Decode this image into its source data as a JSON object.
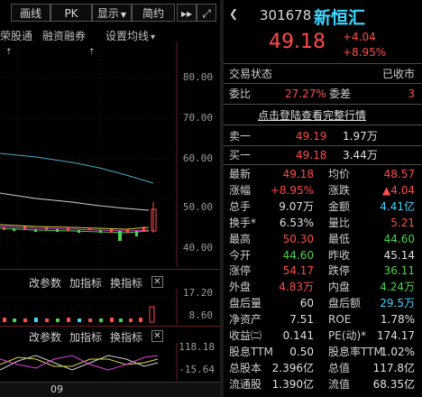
{
  "toolbar": {
    "btn1": "画线",
    "btn2": "PK",
    "btn3": "显示",
    "btn4": "简约",
    "btn5": "▸▸",
    "btn6": "⤢"
  },
  "subbar": {
    "left_label": "荣股通",
    "label2": "融资融券",
    "label3": "设置均线",
    "caret": "▾"
  },
  "price_axis": [
    "80.00",
    "70.00",
    "60.00",
    "50.00",
    "40.00"
  ],
  "indicator_bar1": {
    "change": "改参数",
    "add": "加指标",
    "swap": "换指标",
    "close": "✕"
  },
  "volume_axis": [
    "17.20",
    "8.60"
  ],
  "indicator_bar2": {
    "change": "改参数",
    "add": "加指标",
    "swap": "换指标",
    "close": "✕"
  },
  "osc_axis": [
    "118.18",
    "-15.64"
  ],
  "date_label": "09",
  "quote": {
    "code": "301678",
    "name": "新恒汇",
    "price": "49.18",
    "change": "+4.04",
    "change_pct": "+8.95%",
    "trade_status_label": "交易状态",
    "trade_status": "已收市",
    "weibi_label": "委比",
    "weibi": "27.27%",
    "weicha_label": "委差",
    "weicha": "3",
    "login_link": "点击登陆查看完整行情",
    "sell1_label": "卖一",
    "sell1_price": "49.19",
    "sell1_vol": "1.97万",
    "buy1_label": "买一",
    "buy1_price": "49.18",
    "buy1_vol": "3.44万",
    "rows": [
      {
        "l1": "最新",
        "v1": "49.18",
        "c1": "red",
        "l2": "均价",
        "v2": "48.57",
        "c2": "red"
      },
      {
        "l1": "涨幅",
        "v1": "+8.95%",
        "c1": "red",
        "l2": "涨跌",
        "v2": "▲4.04",
        "c2": "red"
      },
      {
        "l1": "总手",
        "v1": "9.07万",
        "c1": "white",
        "l2": "金额",
        "v2": "4.41亿",
        "c2": "cyan"
      },
      {
        "l1": "换手*",
        "v1": "6.53%",
        "c1": "white",
        "l2": "量比",
        "v2": "5.21",
        "c2": "red"
      },
      {
        "l1": "最高",
        "v1": "50.30",
        "c1": "red",
        "l2": "最低",
        "v2": "44.60",
        "c2": "green"
      },
      {
        "l1": "今开",
        "v1": "44.60",
        "c1": "green",
        "l2": "昨收",
        "v2": "45.14",
        "c2": "white"
      },
      {
        "l1": "涨停",
        "v1": "54.17",
        "c1": "red",
        "l2": "跌停",
        "v2": "36.11",
        "c2": "green"
      },
      {
        "l1": "外盘",
        "v1": "4.83万",
        "c1": "red",
        "l2": "内盘",
        "v2": "4.24万",
        "c2": "green"
      },
      {
        "l1": "盘后量",
        "v1": "60",
        "c1": "white",
        "l2": "盘后额",
        "v2": "29.5万",
        "c2": "cyan"
      },
      {
        "l1": "净资产",
        "v1": "7.51",
        "c1": "white",
        "l2": "ROE",
        "v2": "1.78%",
        "c2": "white"
      },
      {
        "l1": "收益㈡",
        "v1": "0.141",
        "c1": "white",
        "l2": "PE(动)*",
        "v2": "174.17",
        "c2": "white"
      },
      {
        "l1": "股息TTM",
        "v1": "0.50",
        "c1": "white",
        "l2": "股息率TTM",
        "v2": "1.02%",
        "c2": "white"
      },
      {
        "l1": "总股本",
        "v1": "2.396亿",
        "c1": "white",
        "l2": "总值",
        "v2": "117.8亿",
        "c2": "white"
      },
      {
        "l1": "流通股",
        "v1": "1.390亿",
        "c1": "white",
        "l2": "流值",
        "v2": "68.35亿",
        "c2": "white"
      }
    ]
  },
  "colors": {
    "up": "#ff4a4a",
    "down": "#4cd24c",
    "accent": "#3fd6ff",
    "name": "#f3e04a"
  }
}
